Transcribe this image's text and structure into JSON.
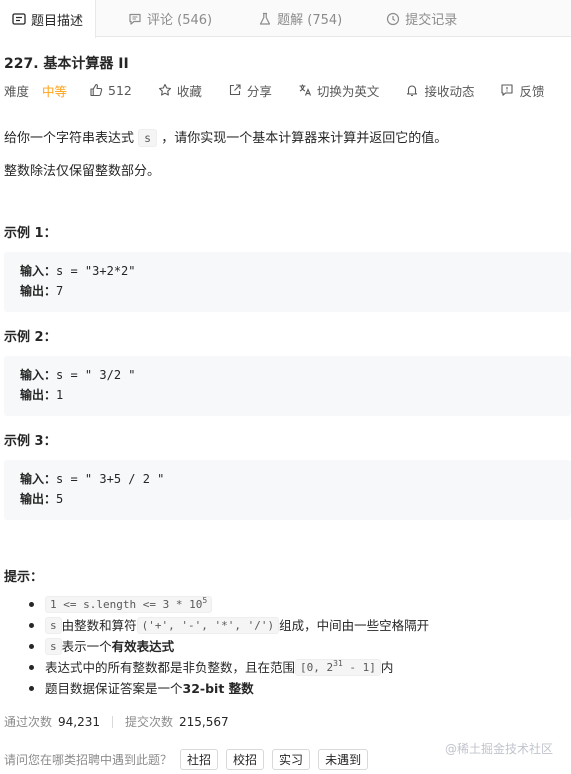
{
  "tabs": [
    {
      "label": "题目描述",
      "icon": "description-icon"
    },
    {
      "label": "评论 (546)",
      "icon": "comment-icon"
    },
    {
      "label": "题解 (754)",
      "icon": "flask-icon"
    },
    {
      "label": "提交记录",
      "icon": "clock-icon"
    }
  ],
  "problem": {
    "title": "227. 基本计算器 II",
    "difficulty_label": "难度",
    "difficulty": "中等",
    "likes": "512",
    "favorite": "收藏",
    "share": "分享",
    "translate": "切换为英文",
    "notify": "接收动态",
    "feedback": "反馈",
    "desc_before": "给你一个字符串表达式 ",
    "desc_code": "s",
    "desc_after": " ，请你实现一个基本计算器来计算并返回它的值。",
    "desc2": "整数除法仅保留整数部分。"
  },
  "examples": [
    {
      "title": "示例 1：",
      "input_label": "输入：",
      "input": "s = \"3+2*2\"",
      "output_label": "输出：",
      "output": "7"
    },
    {
      "title": "示例 2：",
      "input_label": "输入：",
      "input": "s = \" 3/2 \"",
      "output_label": "输出：",
      "output": "1"
    },
    {
      "title": "示例 3：",
      "input_label": "输入：",
      "input": "s = \" 3+5 / 2 \"",
      "output_label": "输出：",
      "output": "5"
    }
  ],
  "hints": {
    "title": "提示：",
    "t1_code": "1 <= s.length <= 3 * 10",
    "t1_sup": "5",
    "t2_code": "s",
    "t2_mid": " 由整数和算符 ",
    "t2_ops": "('+', '-', '*', '/')",
    "t2_end": " 组成，中间由一些空格隔开",
    "t3_code": "s",
    "t3_mid": " 表示一个 ",
    "t3_bold": "有效表达式",
    "t4_text": "表达式中的所有整数都是非负整数，且在范围 ",
    "t4_code_a": "[0, 2",
    "t4_sup": "31",
    "t4_code_b": " - 1]",
    "t4_end": " 内",
    "t5_text": "题目数据保证答案是一个 ",
    "t5_bold": "32-bit 整数"
  },
  "stats": {
    "pass_label": "通过次数",
    "pass_value": "94,231",
    "submit_label": "提交次数",
    "submit_value": "215,567"
  },
  "ask": {
    "question": "请问您在哪类招聘中遇到此题？",
    "chips": [
      "社招",
      "校招",
      "实习",
      "未遇到"
    ]
  },
  "watermark": "@稀土掘金技术社区",
  "colors": {
    "difficulty": "#ffa116",
    "code_bg": "#f7f8fa"
  }
}
